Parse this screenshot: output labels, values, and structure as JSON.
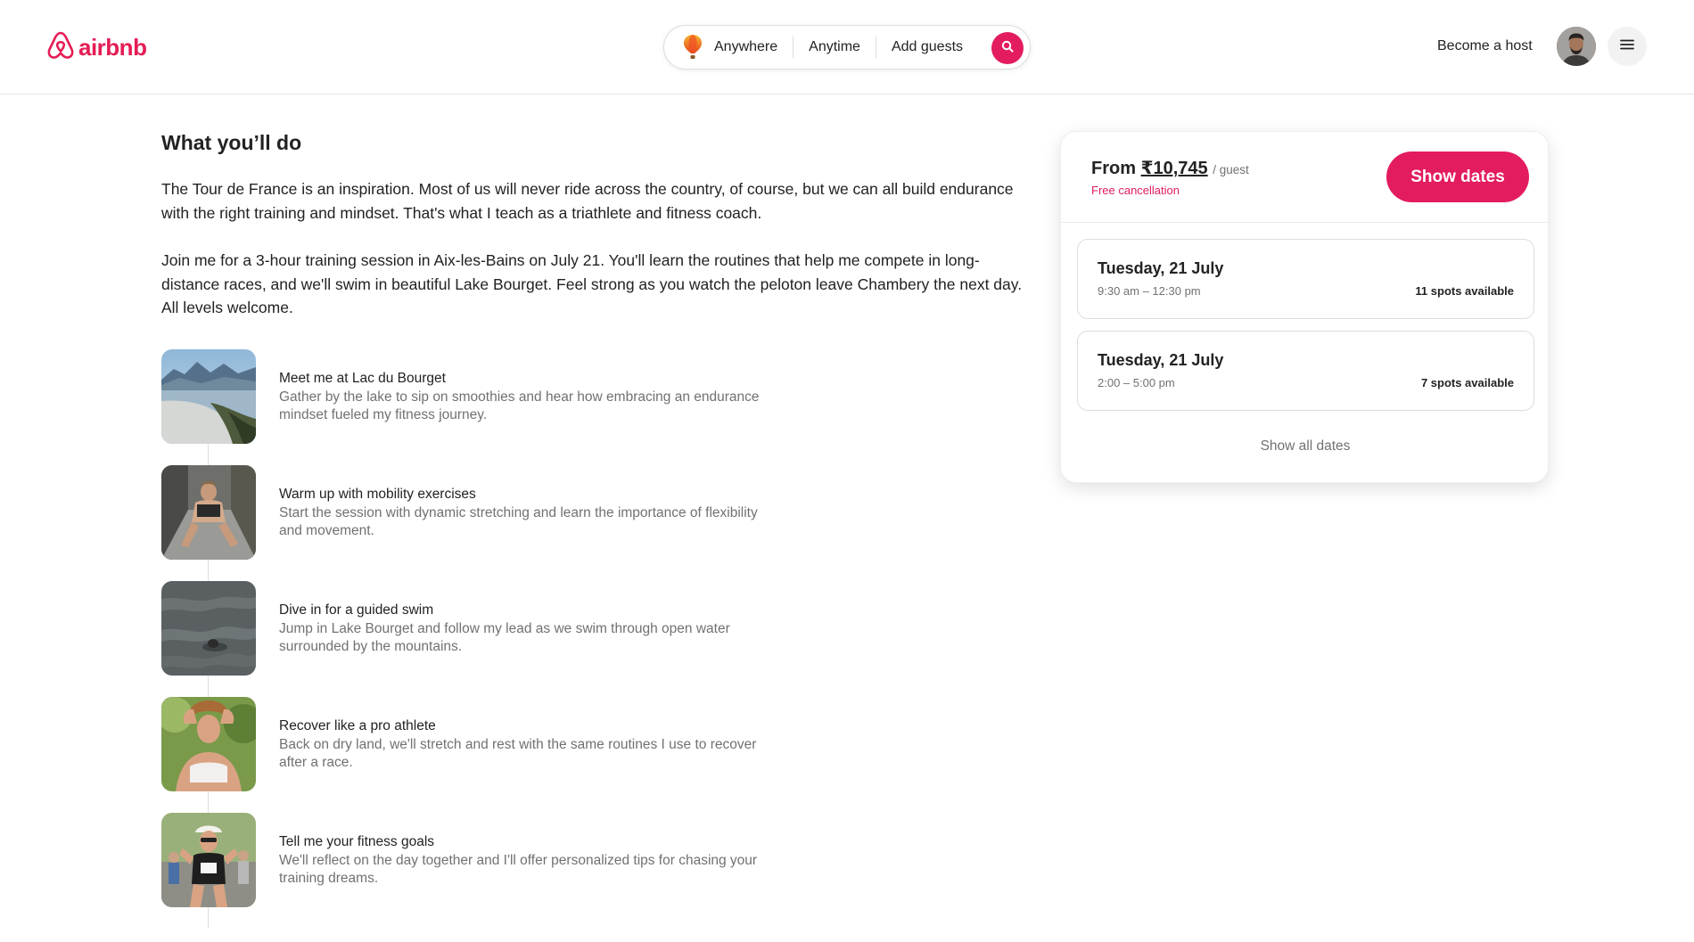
{
  "header": {
    "logo_text": "airbnb",
    "search": {
      "location": "Anywhere",
      "time": "Anytime",
      "guests": "Add guests"
    },
    "become_host": "Become a host"
  },
  "main": {
    "section_title": "What you’ll do",
    "paragraphs": [
      "The Tour de France is an inspiration. Most of us will never ride across the country, of course, but we can all build endurance with the right training and mindset. That's what I teach as a triathlete and fitness coach.",
      "Join me for a 3-hour training session in Aix-les-Bains on July 21. You'll learn the routines that help me compete in long-distance races, and we'll swim in beautiful Lake Bourget. Feel strong as you watch the peloton leave Chambery the next day. All levels welcome."
    ],
    "steps": [
      {
        "title": "Meet me at Lac du Bourget",
        "desc": "Gather by the lake to sip on smoothies and hear how embracing an endurance mindset fueled my fitness journey."
      },
      {
        "title": "Warm up with mobility exercises",
        "desc": "Start the session with dynamic stretching and learn the importance of flexibility and movement."
      },
      {
        "title": "Dive in for a guided swim",
        "desc": "Jump in Lake Bourget and follow my lead as we swim through open water surrounded by the mountains."
      },
      {
        "title": "Recover like a pro athlete",
        "desc": "Back on dry land, we'll stretch and rest with the same routines I use to recover after a race."
      },
      {
        "title": "Tell me your fitness goals",
        "desc": "We'll reflect on the day together and I'll offer personalized tips for chasing your training dreams."
      }
    ]
  },
  "booking": {
    "from_label": "From",
    "price": "₹10,745",
    "per_guest": "/ guest",
    "free_cancellation": "Free cancellation",
    "show_dates_button": "Show dates",
    "dates": [
      {
        "day": "Tuesday, 21 July",
        "time": "9:30 am – 12:30 pm",
        "spots": "11 spots available"
      },
      {
        "day": "Tuesday, 21 July",
        "time": "2:00 – 5:00 pm",
        "spots": "7 spots available"
      }
    ],
    "show_all_dates": "Show all dates"
  },
  "colors": {
    "brand": "#e31c5f",
    "text_primary": "#222222",
    "text_secondary": "#717171",
    "border": "#dddddd"
  },
  "icons": {
    "logo": "airbnb-logo-icon",
    "balloon": "hot-air-balloon-icon",
    "search": "search-icon",
    "menu": "hamburger-menu-icon"
  }
}
